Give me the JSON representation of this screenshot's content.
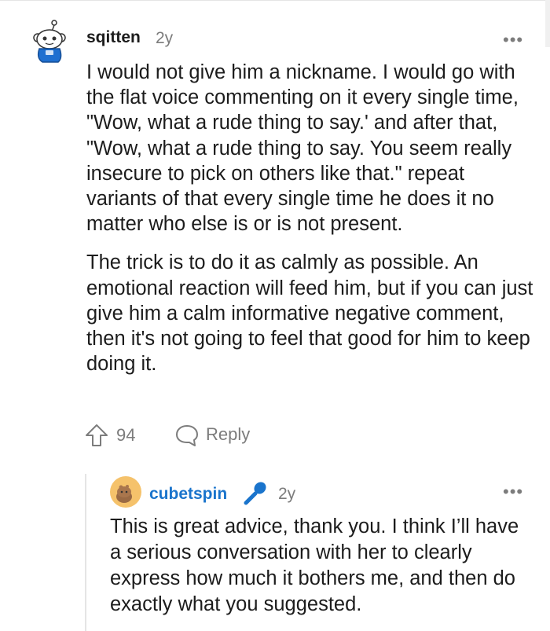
{
  "comments": [
    {
      "username": "sqitten",
      "time": "2y",
      "more": "•••",
      "paragraphs": [
        "I would not give him a nickname. I would go with the flat voice commenting on it every single time, \"Wow, what a rude thing to say.' and after that, \"Wow, what a rude thing to say. You seem really insecure to pick on others like that.\" repeat variants of that every single time he does it no matter who else is or is not present.",
        "The trick is to do it as calmly as possible. An emotional reaction will feed him, but if you can just give him a calm informative negative comment, then it's not going to feel that good for him to keep doing it."
      ],
      "votes": "94",
      "reply_label": "Reply",
      "avatar_icon": "snoo-avatar-icon"
    },
    {
      "username": "cubetspin",
      "time": "2y",
      "more": "•••",
      "paragraphs": [
        "This is great advice, thank you. I think I’ll have a serious conversation with her to clearly express how much it bothers me, and then do exactly what you suggested."
      ],
      "badge_icon": "microphone-icon",
      "avatar_icon": "snoo-avatar-icon"
    }
  ],
  "colors": {
    "username_op": "#1a74cc",
    "meta_gray": "#7c7c7c",
    "text": "#1c1c1c"
  }
}
